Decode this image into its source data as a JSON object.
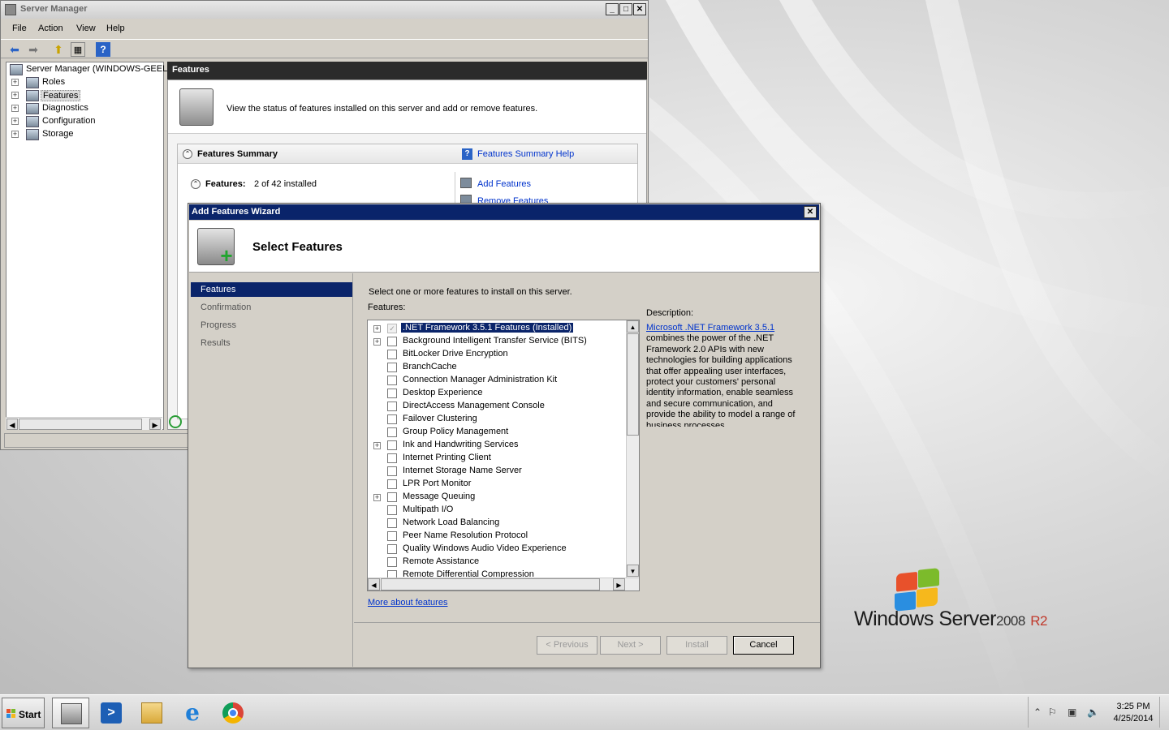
{
  "server_manager": {
    "title": "Server Manager",
    "menu": [
      "File",
      "Action",
      "View",
      "Help"
    ],
    "tree": [
      {
        "label": "Server Manager (WINDOWS-GEELS",
        "icon": "server-manager-icon"
      },
      {
        "label": "Roles",
        "icon": "roles-icon"
      },
      {
        "label": "Features",
        "icon": "features-icon",
        "selected": true
      },
      {
        "label": "Diagnostics",
        "icon": "diagnostics-icon"
      },
      {
        "label": "Configuration",
        "icon": "configuration-icon"
      },
      {
        "label": "Storage",
        "icon": "storage-icon"
      }
    ],
    "pane_title": "Features",
    "intro_text": "View the status of features installed on this server and add or remove features.",
    "summary_title": "Features Summary",
    "summary_help": "Features Summary Help",
    "features_label": "Features:",
    "features_count": "2 of 42 installed",
    "add_features": "Add Features",
    "remove_features": "Remove Features"
  },
  "wizard": {
    "title": "Add Features Wizard",
    "heading": "Select Features",
    "nav": [
      "Features",
      "Confirmation",
      "Progress",
      "Results"
    ],
    "nav_active": "Features",
    "instruction": "Select one or more features to install on this server.",
    "features_label": "Features:",
    "features": [
      {
        "name": ".NET Framework 3.5.1 Features  (Installed)",
        "expandable": true,
        "checked": true,
        "selected": true
      },
      {
        "name": "Background Intelligent Transfer Service (BITS)",
        "expandable": true,
        "checked": false
      },
      {
        "name": "BitLocker Drive Encryption",
        "expandable": false,
        "checked": false
      },
      {
        "name": "BranchCache",
        "expandable": false,
        "checked": false
      },
      {
        "name": "Connection Manager Administration Kit",
        "expandable": false,
        "checked": false
      },
      {
        "name": "Desktop Experience",
        "expandable": false,
        "checked": false
      },
      {
        "name": "DirectAccess Management Console",
        "expandable": false,
        "checked": false
      },
      {
        "name": "Failover Clustering",
        "expandable": false,
        "checked": false
      },
      {
        "name": "Group Policy Management",
        "expandable": false,
        "checked": false
      },
      {
        "name": "Ink and Handwriting Services",
        "expandable": true,
        "checked": false
      },
      {
        "name": "Internet Printing Client",
        "expandable": false,
        "checked": false
      },
      {
        "name": "Internet Storage Name Server",
        "expandable": false,
        "checked": false
      },
      {
        "name": "LPR Port Monitor",
        "expandable": false,
        "checked": false
      },
      {
        "name": "Message Queuing",
        "expandable": true,
        "checked": false
      },
      {
        "name": "Multipath I/O",
        "expandable": false,
        "checked": false
      },
      {
        "name": "Network Load Balancing",
        "expandable": false,
        "checked": false
      },
      {
        "name": "Peer Name Resolution Protocol",
        "expandable": false,
        "checked": false
      },
      {
        "name": "Quality Windows Audio Video Experience",
        "expandable": false,
        "checked": false
      },
      {
        "name": "Remote Assistance",
        "expandable": false,
        "checked": false
      },
      {
        "name": "Remote Differential Compression",
        "expandable": false,
        "checked": false
      }
    ],
    "description_label": "Description:",
    "description_link": "Microsoft .NET Framework 3.5.1",
    "description_text": "combines the power of the .NET Framework 2.0 APIs with new technologies for building applications that offer appealing user interfaces, protect your customers' personal identity information, enable seamless and secure communication, and provide the ability to model a range of business processes.",
    "more_link": "More about features",
    "buttons": {
      "previous": "< Previous",
      "next": "Next >",
      "install": "Install",
      "cancel": "Cancel"
    }
  },
  "branding": {
    "windows_server": "Windows Server",
    "version": "2008",
    "r2": "R2"
  },
  "taskbar": {
    "start": "Start",
    "apps": [
      "server-manager-icon",
      "powershell-icon",
      "explorer-icon",
      "internet-explorer-icon",
      "chrome-icon"
    ],
    "clock_time": "3:25 PM",
    "clock_date": "4/25/2014"
  },
  "colors": {
    "title_active": "#0a246a",
    "selection": "#0a246a",
    "link": "#0033cc",
    "r2_red": "#c0392b"
  }
}
